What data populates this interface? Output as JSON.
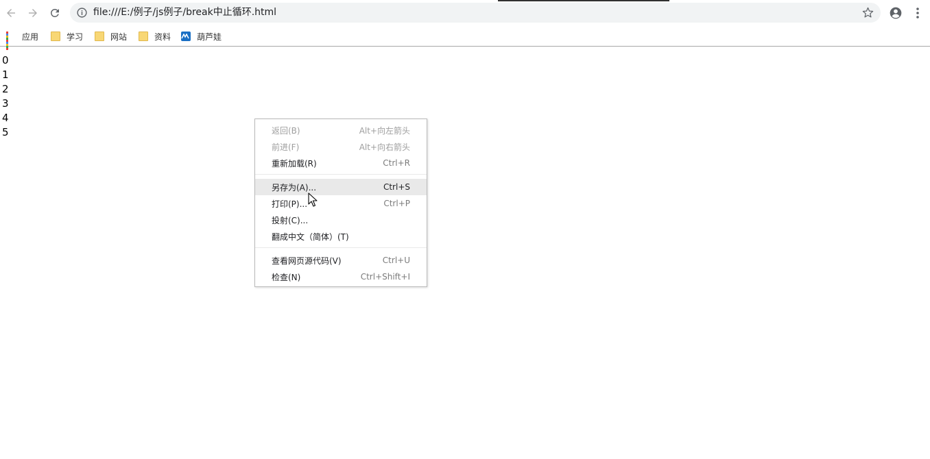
{
  "browser": {
    "url": "file:///E:/例子/js例子/break中止循环.html",
    "icons": {
      "back": "arrow-left-icon",
      "forward": "arrow-right-icon",
      "reload": "reload-icon",
      "info": "info-icon",
      "bookmark_star": "star-icon",
      "profile": "account-circle-icon",
      "menu": "kebab-menu-icon"
    }
  },
  "bookmarks": [
    {
      "label": "应用",
      "icon": "apps-grid-icon"
    },
    {
      "label": "学习",
      "icon": "folder-icon"
    },
    {
      "label": "网站",
      "icon": "folder-icon"
    },
    {
      "label": "资料",
      "icon": "folder-icon"
    },
    {
      "label": "葫芦娃",
      "icon": "site-logo-icon"
    }
  ],
  "page": {
    "lines": [
      "0",
      "1",
      "2",
      "3",
      "4",
      "5"
    ]
  },
  "context_menu": {
    "items": [
      {
        "label": "返回(B)",
        "shortcut": "Alt+向左箭头",
        "disabled": true
      },
      {
        "label": "前进(F)",
        "shortcut": "Alt+向右箭头",
        "disabled": true
      },
      {
        "label": "重新加载(R)",
        "shortcut": "Ctrl+R",
        "disabled": false
      },
      {
        "label": "另存为(A)...",
        "shortcut": "Ctrl+S",
        "disabled": false,
        "highlighted": true
      },
      {
        "label": "打印(P)...",
        "shortcut": "Ctrl+P",
        "disabled": false
      },
      {
        "label": "投射(C)...",
        "shortcut": "",
        "disabled": false
      },
      {
        "label": "翻成中文（简体）(T)",
        "shortcut": "",
        "disabled": false
      },
      {
        "label": "查看网页源代码(V)",
        "shortcut": "Ctrl+U",
        "disabled": false
      },
      {
        "label": "检查(N)",
        "shortcut": "Ctrl+Shift+I",
        "disabled": false
      }
    ]
  },
  "colors": {
    "omnibox_bg": "#f1f3f4",
    "menu_hover": "#e9e9e9",
    "folder": "#f8d775"
  }
}
